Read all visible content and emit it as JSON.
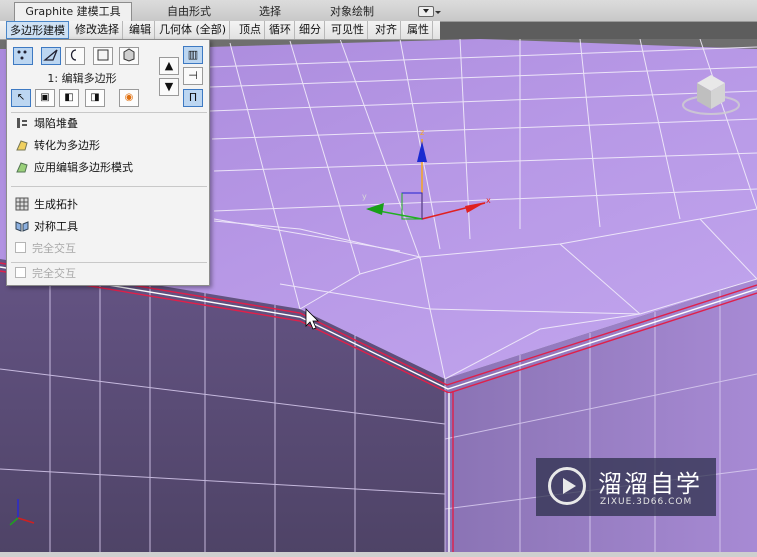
{
  "ribbon": {
    "tabs": [
      {
        "label": "Graphite 建模工具",
        "active": true
      },
      {
        "label": "自由形式",
        "active": false
      },
      {
        "label": "选择",
        "active": false
      },
      {
        "label": "对象绘制",
        "active": false
      }
    ],
    "subtabs": [
      {
        "label": "多边形建模",
        "active": true
      },
      {
        "label": "修改选择"
      },
      {
        "label": "编辑"
      },
      {
        "label": "几何体 (全部)"
      },
      {
        "label": "顶点"
      },
      {
        "label": "循环"
      },
      {
        "label": "细分"
      },
      {
        "label": "可见性"
      },
      {
        "label": "对齐"
      },
      {
        "label": "属性"
      }
    ]
  },
  "panel": {
    "modifier_label": "1: 编辑多边形",
    "selection_modes": [
      "vertex-icon",
      "edge-icon",
      "border-icon",
      "polygon-icon",
      "element-icon"
    ],
    "menu": {
      "collapse_stack": "塌陷堆叠",
      "convert_to_poly": "转化为多边形",
      "apply_edit_poly": "应用编辑多边形模式",
      "generate_topology": "生成拓扑",
      "symmetry_tools": "对称工具",
      "full_interop_1": "完全交互",
      "full_interop_2": "完全交互"
    }
  },
  "viewport": {
    "gizmo": {
      "z": "z",
      "y": "y",
      "x": "x"
    }
  },
  "watermark": {
    "title": "溜溜自学",
    "url": "ZIXUE.3D66.COM"
  },
  "colors": {
    "mesh_top": "#b896e6",
    "mesh_side": "#5e4f78",
    "selection_edge": "#e0204a",
    "accent": "#3d79c2"
  }
}
